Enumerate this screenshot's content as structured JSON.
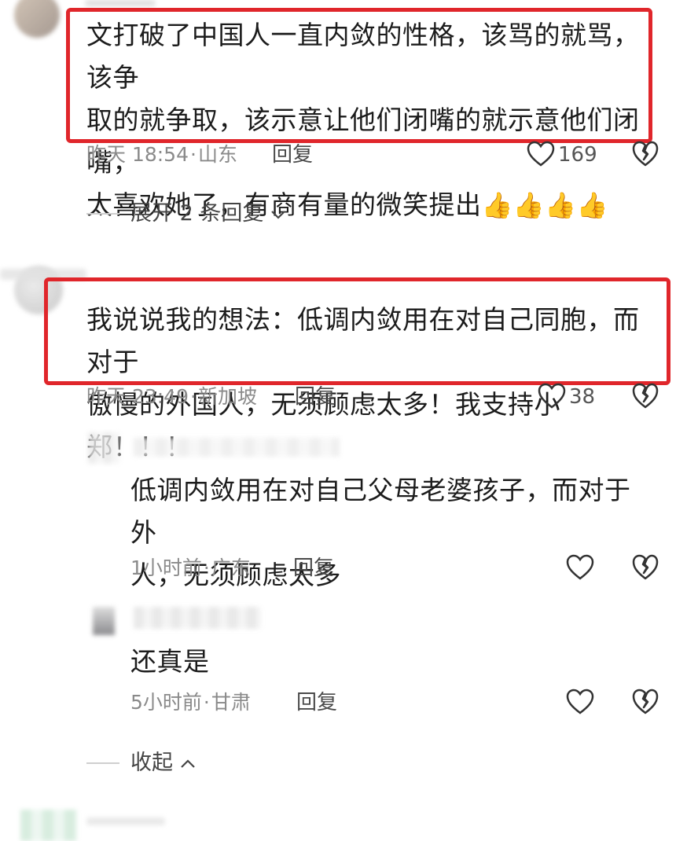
{
  "comments": [
    {
      "text": "文打破了中国人一直内敛的性格，该骂的就骂，该争取的就争取，该示意让他们闭嘴的就示意他们闭嘴，太喜欢她了，有商有量的微笑提出",
      "line1": "文打破了中国人一直内敛的性格，该骂的就骂，该争",
      "line2": "取的就争取，该示意让他们闭嘴的就示意他们闭嘴，",
      "line3": "太喜欢她了，有商有量的微笑提出",
      "emoji": "👍👍👍👍",
      "time": "昨天 18:54",
      "location": "山东",
      "reply_label": "回复",
      "likes": "169",
      "expand_label": "展开 2 条回复"
    },
    {
      "line1": "我说说我的想法：低调内敛用在对自己同胞，而对于",
      "line2": "傲慢的外国人，无须顾虑太多！我支持小郑！！！",
      "time": "昨天 23:49",
      "location": "新加坡",
      "reply_label": "回复",
      "likes": "38"
    }
  ],
  "replies": [
    {
      "line1": "低调内敛用在对自己父母老婆孩子，而对于外",
      "line2": "人，无须顾虑太多",
      "time": "1小时前",
      "location": "广东",
      "reply_label": "回复"
    },
    {
      "line1": "还真是",
      "time": "5小时前",
      "location": "甘肃",
      "reply_label": "回复"
    }
  ],
  "collapse_label": "收起",
  "separator": "·",
  "colors": {
    "highlight_border": "#e0262b",
    "meta_text": "#8a8a8a"
  },
  "icons": [
    "heart-icon",
    "broken-heart-icon",
    "chevron-down-icon",
    "chevron-up-icon",
    "thumbs-up-icon"
  ]
}
